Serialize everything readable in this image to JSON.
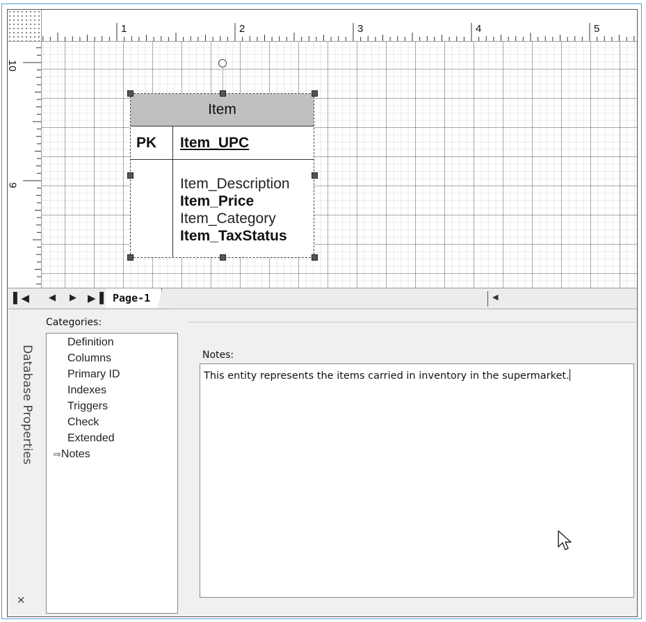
{
  "rulers": {
    "horizontal_labels": [
      "1",
      "2",
      "3",
      "4",
      "5"
    ],
    "vertical_labels": [
      "10",
      "9"
    ]
  },
  "entity": {
    "name": "Item",
    "pk_label": "PK",
    "pk_field": "Item_UPC",
    "attributes": [
      {
        "name": "Item_Description",
        "bold": false
      },
      {
        "name": "Item_Price",
        "bold": true
      },
      {
        "name": "Item_Category",
        "bold": false
      },
      {
        "name": "Item_TaxStatus",
        "bold": true
      }
    ]
  },
  "page_tabs": {
    "nav": [
      "first-page",
      "previous-page",
      "next-page",
      "last-page"
    ],
    "active_tab": "Page-1"
  },
  "properties_panel": {
    "title": "Database Properties",
    "close_glyph": "×",
    "categories_label": "Categories:",
    "categories": [
      "Definition",
      "Columns",
      "Primary ID",
      "Indexes",
      "Triggers",
      "Check",
      "Extended",
      "Notes"
    ],
    "selected_category": "Notes",
    "notes_label": "Notes:",
    "notes_value": "This entity represents the items carried in inventory in the supermarket."
  }
}
